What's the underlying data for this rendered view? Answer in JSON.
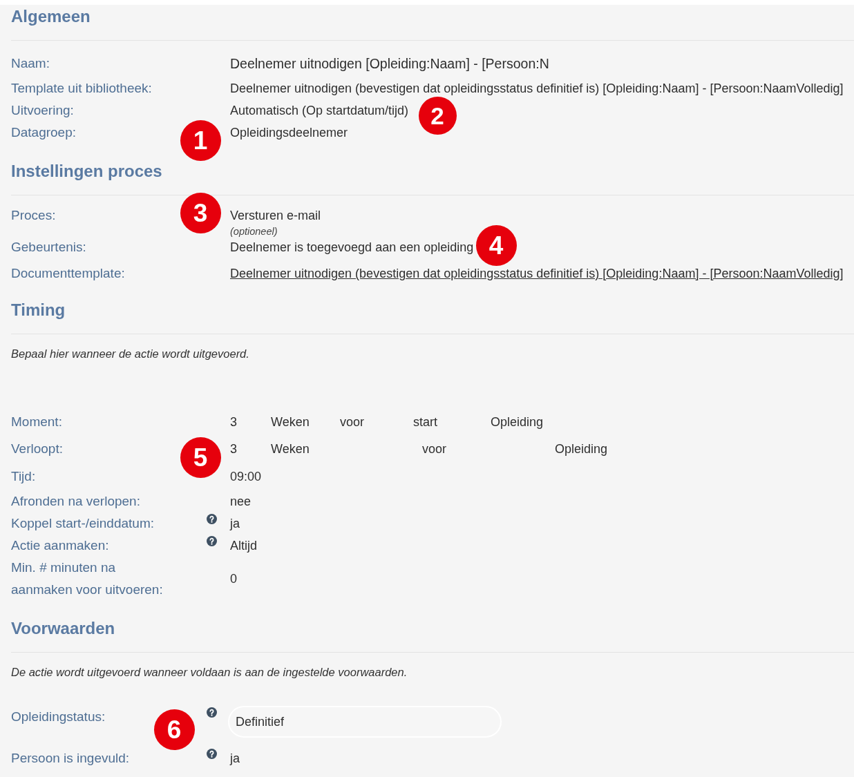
{
  "sections": [
    {
      "title": "Algemeen",
      "rows": [
        {
          "label": "Naam:",
          "kind": "input",
          "value": "Deelnemer uitnodigen [Opleiding:Naam] - [Persoon:N",
          "help": false
        },
        {
          "label": "Template uit bibliotheek:",
          "kind": "text",
          "value": "Deelnemer uitnodigen (bevestigen dat opleidingsstatus definitief is) [Opleiding:Naam] - [Persoon:NaamVolledig]",
          "help": false
        },
        {
          "label": "Uitvoering:",
          "kind": "text",
          "value": "Automatisch (Op startdatum/tijd)",
          "help": false
        },
        {
          "label": "Datagroep:",
          "kind": "text",
          "value": "Opleidingsdeelnemer",
          "help": false
        }
      ]
    },
    {
      "title": "Instellingen proces",
      "rows": [
        {
          "label": "Proces:",
          "kind": "text",
          "value": "Versturen e-mail",
          "note": "(optioneel)",
          "help": false
        },
        {
          "label": "Gebeurtenis:",
          "kind": "text",
          "value": "Deelnemer is toegevoegd aan een opleiding",
          "help": false
        },
        {
          "label": "Documenttemplate:",
          "kind": "link",
          "value": "Deelnemer uitnodigen (bevestigen dat opleidingsstatus definitief is) [Opleiding:Naam] - [Persoon:NaamVolledig]",
          "help": false
        }
      ]
    },
    {
      "title": "Timing",
      "description": "Bepaal hier wanneer de actie wordt uitgevoerd.",
      "rows": [
        {
          "label": "Moment:",
          "kind": "parts",
          "parts": [
            "3",
            "Weken",
            "voor",
            "start",
            "Opleiding"
          ],
          "help": false
        },
        {
          "label": "Verloopt:",
          "kind": "parts",
          "parts": [
            "3",
            "Weken",
            "voor",
            "Opleiding"
          ],
          "help": false
        },
        {
          "label": "Tijd:",
          "kind": "text",
          "value": "09:00",
          "help": false
        },
        {
          "label": "Afronden na verlopen:",
          "kind": "text",
          "value": "nee",
          "help": false
        },
        {
          "label": "Koppel start-/einddatum:",
          "kind": "text",
          "value": "ja",
          "help": true
        },
        {
          "label": "Actie aanmaken:",
          "kind": "text",
          "value": "Altijd",
          "help": true
        },
        {
          "label": "Min. # minuten na aanmaken voor uitvoeren:",
          "kind": "text",
          "value": "0",
          "help": false
        }
      ]
    },
    {
      "title": "Voorwaarden",
      "description": "De actie wordt uitgevoerd wanneer voldaan is aan de ingestelde voorwaarden.",
      "rows": [
        {
          "label": "Opleidingstatus:",
          "kind": "field",
          "value": "Definitief",
          "help": true
        },
        {
          "label": "Persoon is ingevuld:",
          "kind": "text",
          "value": "ja",
          "help": true
        }
      ]
    }
  ],
  "callouts": [
    "1",
    "2",
    "3",
    "4",
    "5",
    "6"
  ]
}
